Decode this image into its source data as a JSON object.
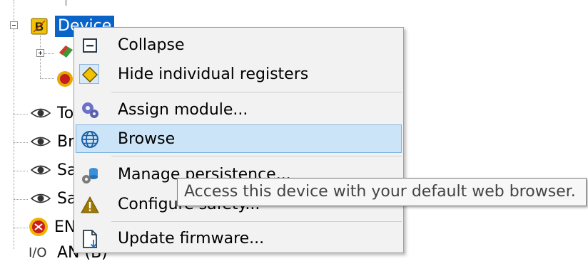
{
  "tree": {
    "device_label": "Device",
    "partial_rows": [
      {
        "id": "eye1",
        "label": "To",
        "icon": "eye-icon"
      },
      {
        "id": "eye2",
        "label": "Br",
        "icon": "eye-icon"
      },
      {
        "id": "eye3",
        "label": "Sa",
        "icon": "eye-icon"
      },
      {
        "id": "eye4",
        "label": "Sa",
        "icon": "eye-icon"
      },
      {
        "id": "en",
        "label": "EN",
        "icon": "emergency-icon"
      },
      {
        "id": "io",
        "label": "AN (B)",
        "prefix": "I/O",
        "icon": "io-icon"
      }
    ]
  },
  "context_menu": {
    "items": [
      {
        "label": "Collapse",
        "icon": "collapse-icon"
      },
      {
        "label": "Hide individual registers",
        "icon": "diamond-icon",
        "checked": true
      },
      {
        "label": "Assign module...",
        "icon": "gears-icon"
      },
      {
        "label": "Browse",
        "icon": "globe-icon",
        "highlighted": true
      },
      {
        "label": "Manage persistence...",
        "icon": "database-gear-icon"
      },
      {
        "label": "Configure safety...",
        "icon": "warning-icon"
      },
      {
        "label": "Update firmware...",
        "icon": "document-download-icon"
      }
    ]
  },
  "tooltip": {
    "text": "Access this device with your default web browser."
  },
  "colors": {
    "selection": "#0a64c8",
    "menu_bg": "#f2f2f2",
    "hover_bg": "#cce4f7",
    "hover_border": "#7fb4de"
  }
}
